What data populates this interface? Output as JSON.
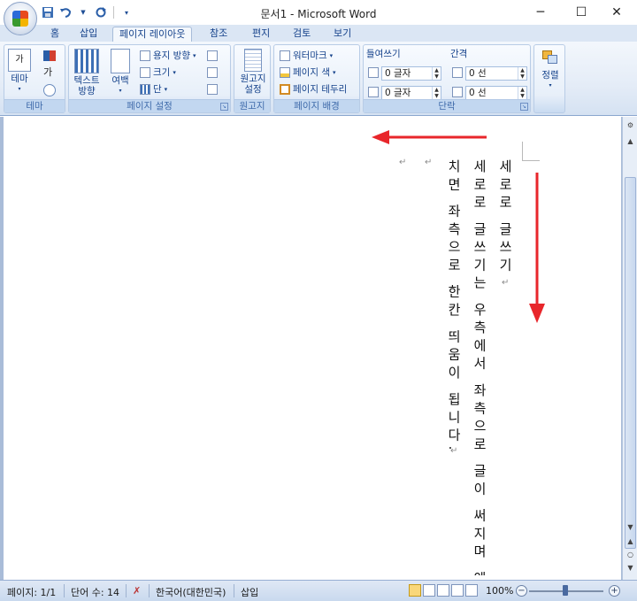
{
  "window": {
    "title": "문서1 - Microsoft Word",
    "minimize": "─",
    "maximize": "☐",
    "close": "✕"
  },
  "qat": {
    "save_icon": "save-icon",
    "undo_icon": "undo-icon",
    "redo_icon": "redo-icon"
  },
  "tabs": [
    {
      "label": "홈"
    },
    {
      "label": "삽입"
    },
    {
      "label": "페이지 레이아웃"
    },
    {
      "label": "참조"
    },
    {
      "label": "편지"
    },
    {
      "label": "검토"
    },
    {
      "label": "보기"
    }
  ],
  "ribbon": {
    "theme_group": {
      "label": "테마",
      "theme_button": "테마",
      "color_glyph": "가"
    },
    "page_setup_group": {
      "label": "페이지 설정",
      "text_direction": "텍스트\n방향",
      "text_direction_l1": "텍스트",
      "text_direction_l2": "방향",
      "margins": "여백",
      "orientation": "용지 방향",
      "size": "크기",
      "columns": "단"
    },
    "manuscript_group": {
      "label": "원고지",
      "button_l1": "원고지",
      "button_l2": "설정"
    },
    "page_background_group": {
      "label": "페이지 배경",
      "watermark": "워터마크",
      "page_color": "페이지 색",
      "page_borders": "페이지 테두리"
    },
    "paragraph_group": {
      "label": "단락",
      "indent_label": "들여쓰기",
      "spacing_label": "간격",
      "indent_left": "0 글자",
      "indent_right": "0 글자",
      "spacing_before": "0 선",
      "spacing_after": "0 선"
    },
    "arrange_group": {
      "label": "정렬",
      "button": "정렬"
    }
  },
  "document": {
    "line1": "세로로 글쓰기",
    "line2": "세로로 글쓰기는 우측에서 좌측으로 글이 써지며 엔",
    "line3": "치면 좌측으로 한칸 띄움이 됩니다.",
    "para_mark": "↵",
    "arrow_color": "#e8262b"
  },
  "status": {
    "page": "페이지: 1/1",
    "words": "단어 수: 14",
    "language": "한국어(대한민국)",
    "mode": "삽입",
    "zoom": "100%",
    "zoom_out": "−",
    "zoom_in": "+"
  }
}
